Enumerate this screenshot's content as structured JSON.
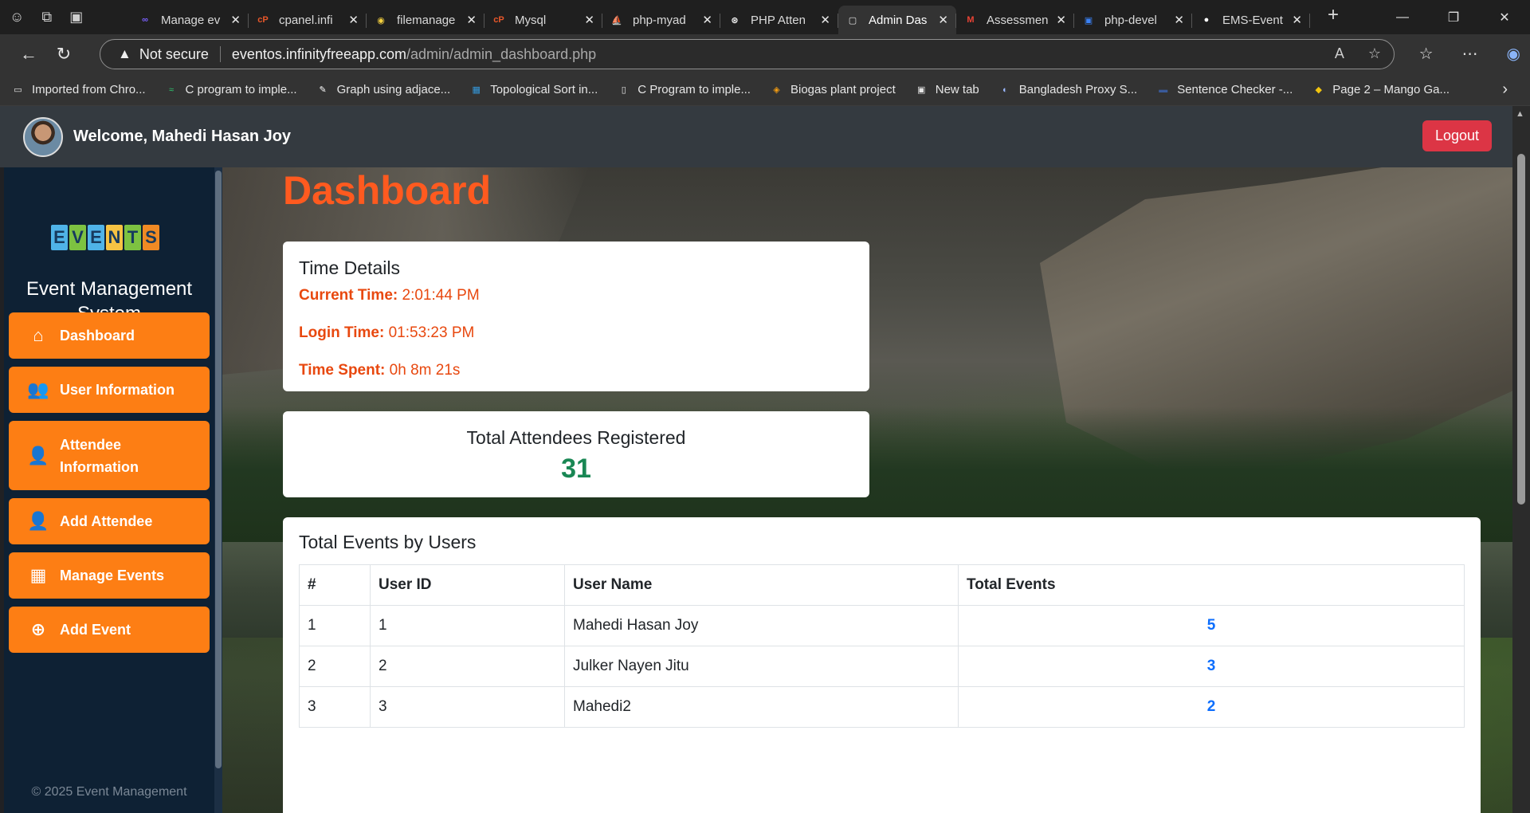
{
  "browser": {
    "tabs": [
      {
        "title": "Manage ev",
        "fav": "∞",
        "fav_color": "#7b61ff"
      },
      {
        "title": "cpanel.infi",
        "fav": "cP",
        "fav_color": "#e8572a"
      },
      {
        "title": "filemanage",
        "fav": "◉",
        "fav_color": "#f4d03f"
      },
      {
        "title": "Mysql",
        "fav": "cP",
        "fav_color": "#e8572a"
      },
      {
        "title": "php-myad",
        "fav": "⛵",
        "fav_color": "#f0a500"
      },
      {
        "title": "PHP Atten",
        "fav": "⊛",
        "fav_color": "#ffffff"
      },
      {
        "title": "Admin Das",
        "fav": "▢",
        "fav_color": "#e0e0e0",
        "active": true
      },
      {
        "title": "Assessmen",
        "fav": "M",
        "fav_color": "#ea4335"
      },
      {
        "title": "php-devel",
        "fav": "▣",
        "fav_color": "#3b82f6"
      },
      {
        "title": "EMS-Event",
        "fav": "●",
        "fav_color": "#ffffff"
      }
    ],
    "address": {
      "security": "Not secure",
      "host": "eventos.infinityfreeapp.com",
      "path": "/admin/admin_dashboard.php"
    },
    "bookmarks": [
      {
        "label": "Imported from Chro...",
        "icon": "▭",
        "color": "#e6e6e6"
      },
      {
        "label": "C program to imple...",
        "icon": "≈",
        "color": "#2ecc71"
      },
      {
        "label": "Graph using adjace...",
        "icon": "✎",
        "color": "#ffffff"
      },
      {
        "label": "Topological Sort in...",
        "icon": "▦",
        "color": "#3498db"
      },
      {
        "label": "C Program to imple...",
        "icon": "▯",
        "color": "#e6e6e6"
      },
      {
        "label": "Biogas plant project",
        "icon": "◈",
        "color": "#f39c12"
      },
      {
        "label": "New tab",
        "icon": "▣",
        "color": "#e6e6e6"
      },
      {
        "label": "Bangladesh Proxy S...",
        "icon": "◐",
        "color": "#9bb7ff"
      },
      {
        "label": "Sentence Checker -...",
        "icon": "▬",
        "color": "#3a5a9a"
      },
      {
        "label": "Page 2 – Mango Ga...",
        "icon": "◆",
        "color": "#f1c40f"
      }
    ]
  },
  "header": {
    "welcome": "Welcome, Mahedi Hasan Joy",
    "logout": "Logout"
  },
  "sidebar": {
    "logo_letters": [
      "E",
      "V",
      "E",
      "N",
      "T",
      "S"
    ],
    "logo_colors": [
      "#4fb3e8",
      "#7dc241",
      "#4fb3e8",
      "#f6c343",
      "#7dc241",
      "#f08a24"
    ],
    "title": "Event Management System",
    "items": [
      {
        "label": "Dashboard",
        "icon": "⌂"
      },
      {
        "label": "User Information",
        "icon": "👥"
      },
      {
        "label": "Attendee Information",
        "icon": "👤"
      },
      {
        "label": "Add Attendee",
        "icon": "👤"
      },
      {
        "label": "Manage Events",
        "icon": "▦"
      },
      {
        "label": "Add Event",
        "icon": "⊕"
      }
    ],
    "footer": "© 2025 Event Management"
  },
  "main": {
    "title": "Dashboard",
    "time": {
      "heading": "Time Details",
      "current_label": "Current Time:",
      "current_value": "2:01:44 PM",
      "login_label": "Login Time:",
      "login_value": "01:53:23 PM",
      "spent_label": "Time Spent:",
      "spent_value": "0h 8m 21s"
    },
    "attendees": {
      "heading": "Total Attendees Registered",
      "count": "31"
    },
    "events": {
      "heading": "Total Events by Users",
      "columns": [
        "#",
        "User ID",
        "User Name",
        "Total Events"
      ],
      "rows": [
        {
          "n": "1",
          "uid": "1",
          "name": "Mahedi Hasan Joy",
          "total": "5"
        },
        {
          "n": "2",
          "uid": "2",
          "name": "Julker Nayen Jitu",
          "total": "3"
        },
        {
          "n": "3",
          "uid": "3",
          "name": "Mahedi2",
          "total": "2"
        }
      ]
    }
  }
}
